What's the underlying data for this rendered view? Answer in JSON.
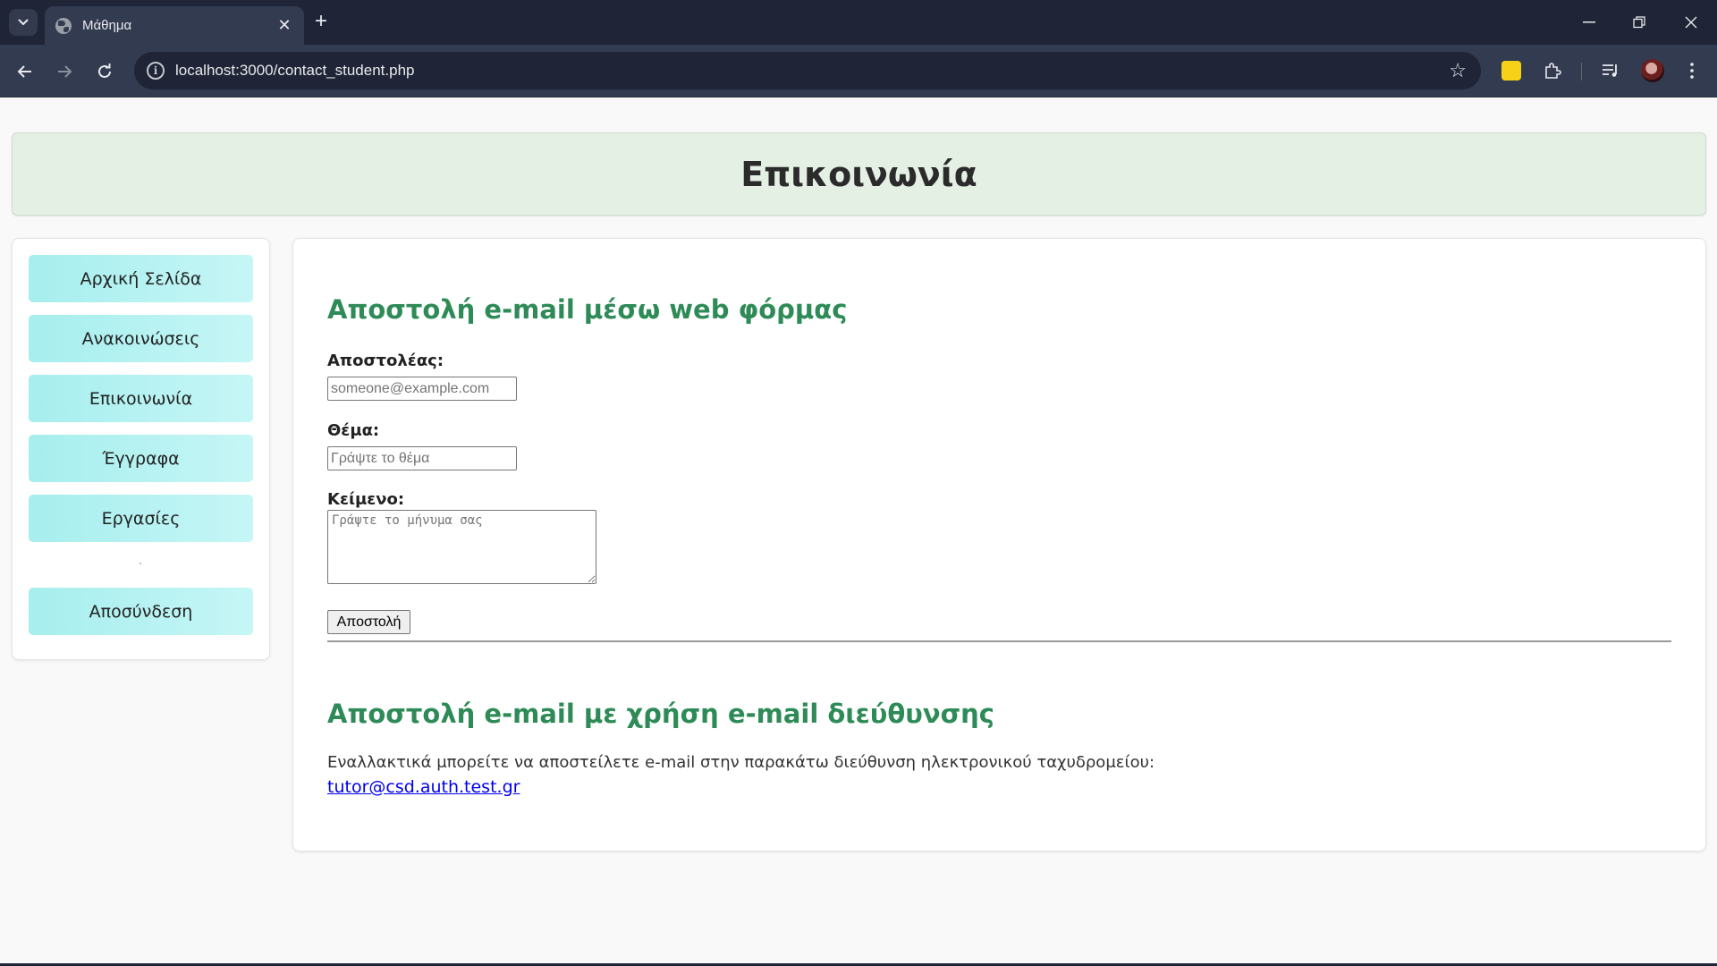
{
  "browser": {
    "tab_title": "Μάθημα",
    "url": "localhost:3000/contact_student.php"
  },
  "header": {
    "title": "Επικοινωνία"
  },
  "sidebar": {
    "items": [
      {
        "label": "Αρχική Σελίδα"
      },
      {
        "label": "Ανακοινώσεις"
      },
      {
        "label": "Επικοινωνία"
      },
      {
        "label": "Έγγραφα"
      },
      {
        "label": "Εργασίες"
      }
    ],
    "logout_label": "Αποσύνδεση"
  },
  "form_section": {
    "title": "Αποστολή e-mail μέσω web φόρμας",
    "sender_label": "Αποστολέας:",
    "sender_placeholder": "someone@example.com",
    "subject_label": "Θέμα:",
    "subject_placeholder": "Γράψτε το θέμα",
    "body_label": "Κείμενο:",
    "body_placeholder": "Γράψτε το μήνυμα σας",
    "submit_label": "Αποστολή"
  },
  "email_section": {
    "title": "Αποστολή e-mail με χρήση e-mail διεύθυνσης",
    "text": "Εναλλακτικά μπορείτε να αποστείλετε e-mail στην παρακάτω διεύθυνση ηλεκτρονικού ταχυδρομείου:",
    "email": "tutor@csd.auth.test.gr"
  }
}
